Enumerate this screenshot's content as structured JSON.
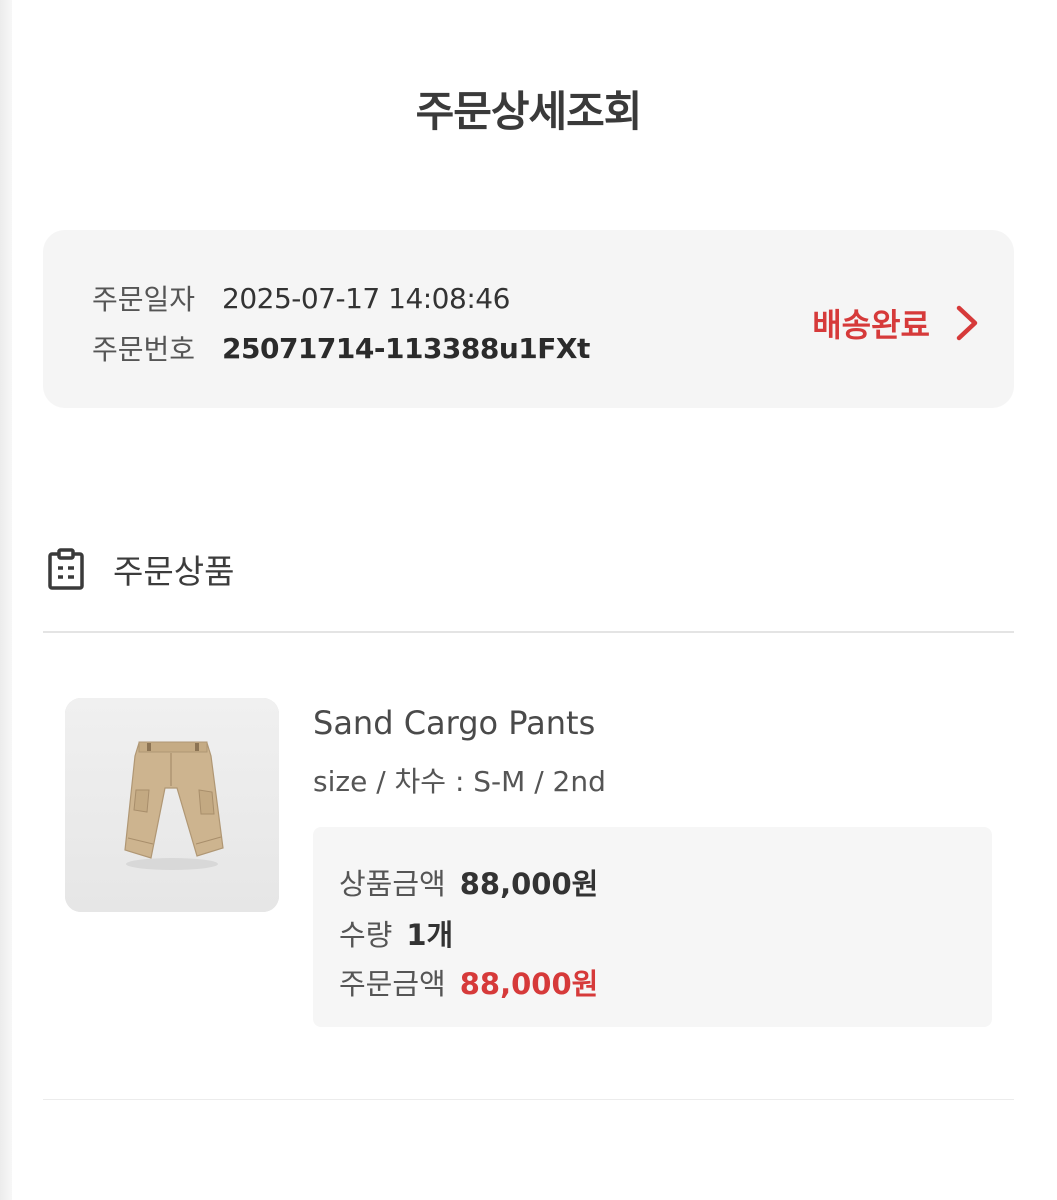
{
  "page": {
    "title": "주문상세조회"
  },
  "order": {
    "date_label": "주문일자",
    "date_value": "2025-07-17 14:08:46",
    "number_label": "주문번호",
    "number_value": "25071714-113388u1FXt",
    "status": "배송완료",
    "status_color": "#d63a3a"
  },
  "section": {
    "title": "주문상품",
    "icon": "clipboard-icon"
  },
  "product": {
    "image": "sand-cargo-pants-thumbnail",
    "name": "Sand Cargo Pants",
    "option": "size / 차수 : S-M / 2nd",
    "price_label": "상품금액",
    "price_value": "88,000원",
    "qty_label": "수량",
    "qty_value": "1개",
    "total_label": "주문금액",
    "total_value": "88,000원"
  }
}
